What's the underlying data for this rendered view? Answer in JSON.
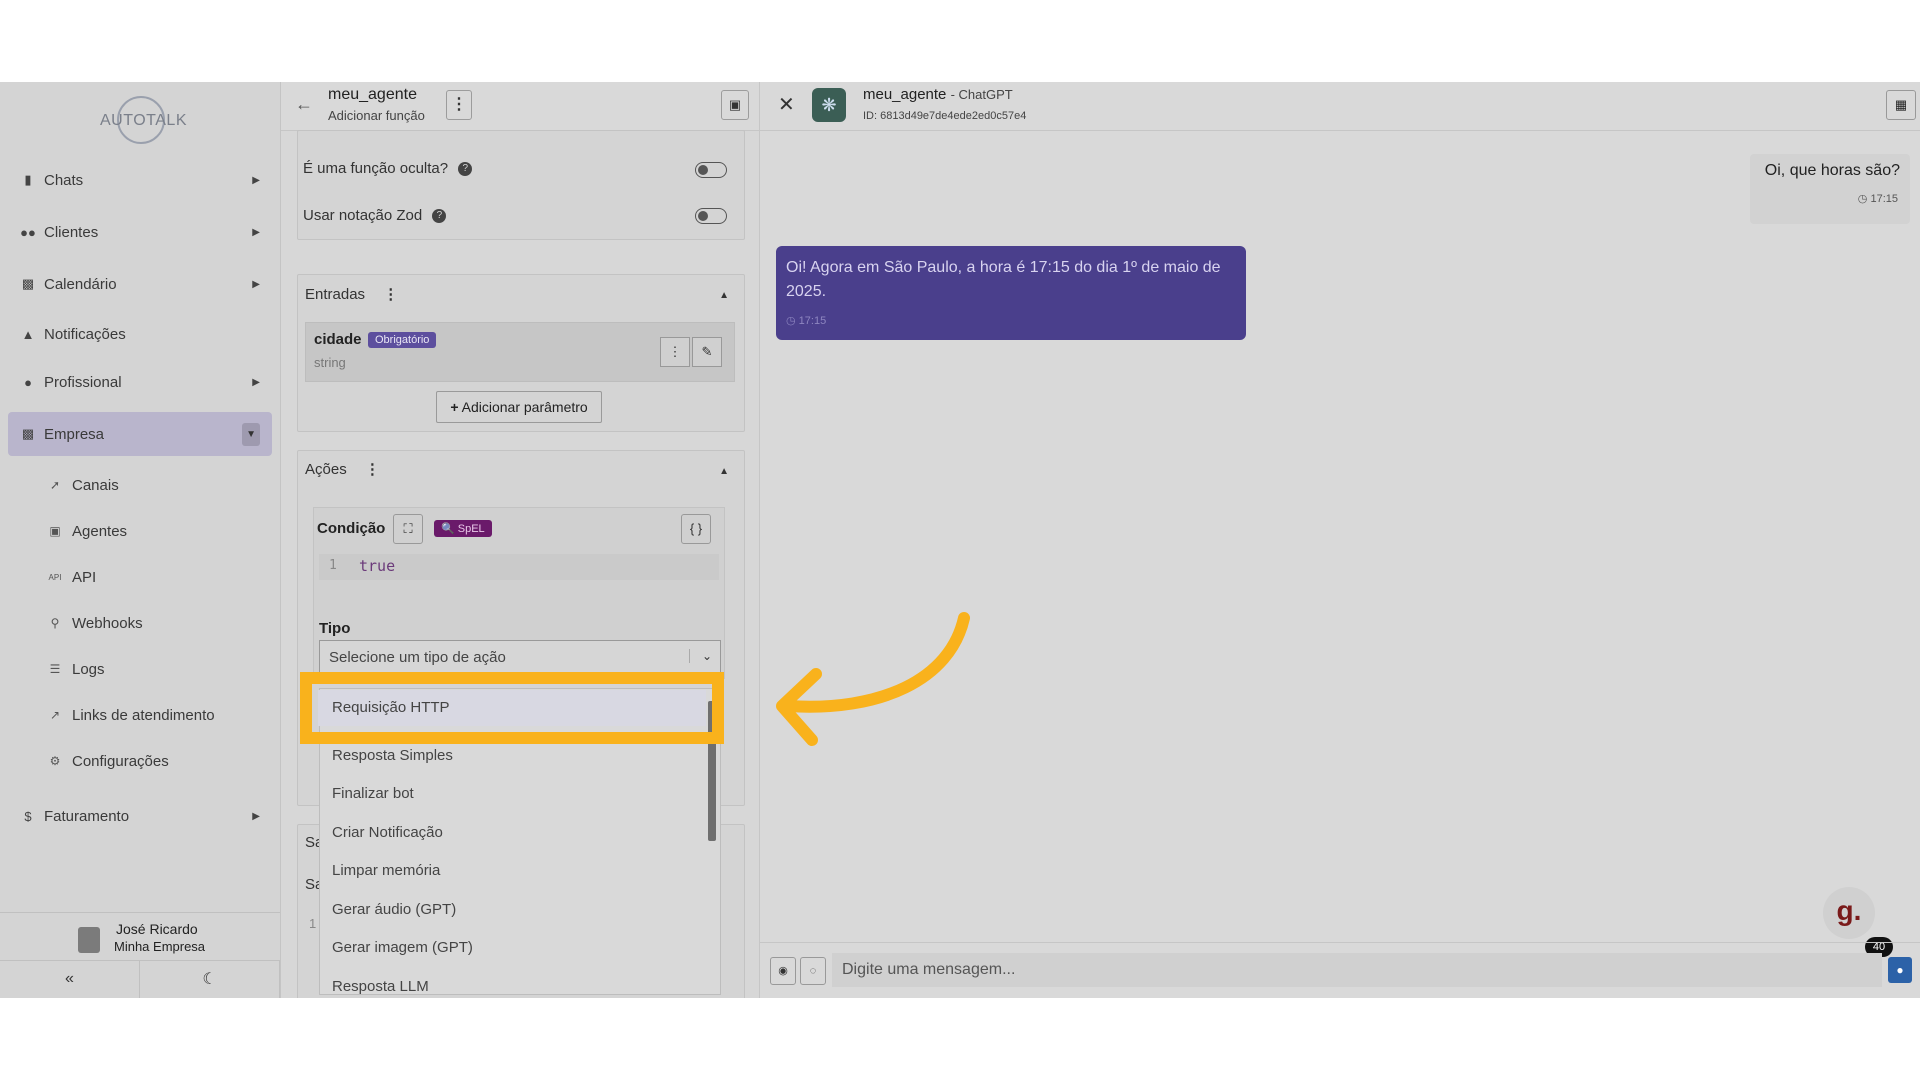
{
  "sidebar": {
    "logo": "AUTOTALK",
    "items": [
      {
        "label": "Chats",
        "icon": "chat-icon"
      },
      {
        "label": "Clientes",
        "icon": "users-icon"
      },
      {
        "label": "Calendário",
        "icon": "calendar-icon"
      },
      {
        "label": "Notificações",
        "icon": "bell-icon"
      },
      {
        "label": "Profissional",
        "icon": "user-tie-icon"
      },
      {
        "label": "Empresa",
        "icon": "building-icon"
      },
      {
        "label": "Faturamento",
        "icon": "dollar-icon"
      }
    ],
    "subitems": [
      {
        "label": "Canais",
        "icon": "rocket-icon"
      },
      {
        "label": "Agentes",
        "icon": "robot-icon"
      },
      {
        "label": "API",
        "icon": "api-icon"
      },
      {
        "label": "Webhooks",
        "icon": "webhook-icon"
      },
      {
        "label": "Logs",
        "icon": "list-icon"
      },
      {
        "label": "Links de atendimento",
        "icon": "external-link-icon"
      },
      {
        "label": "Configurações",
        "icon": "gear-icon"
      }
    ],
    "user": {
      "name": "José Ricardo",
      "company": "Minha Empresa"
    }
  },
  "editor": {
    "title": "meu_agente",
    "subtitle": "Adicionar função",
    "hidden_function_label": "É uma função oculta?",
    "zod_label": "Usar notação Zod",
    "inputs_title": "Entradas",
    "param": {
      "name": "cidade",
      "badge": "Obrigatório",
      "type": "string"
    },
    "add_param_label": "Adicionar parâmetro",
    "actions_title": "Ações",
    "condition_label": "Condição",
    "spel_label": "SpEL",
    "code_line_number": "1",
    "code_text": "true",
    "tipo_label": "Tipo",
    "select_placeholder": "Selecione um tipo de ação",
    "options": [
      "Requisição HTTP",
      "Resposta Simples",
      "Finalizar bot",
      "Criar Notificação",
      "Limpar memória",
      "Gerar áudio (GPT)",
      "Gerar imagem (GPT)",
      "Resposta LLM"
    ],
    "hidden_section_prefix": "Sa",
    "hidden_row_number": "1"
  },
  "chat": {
    "agent_name": "meu_agente",
    "model": "ChatGPT",
    "agent_id": "ID: 6813d49e7de4ede2ed0c57e4",
    "user_message": "Oi, que horas são?",
    "user_time": "17:15",
    "bot_message": "Oi! Agora em São Paulo, a hora é 17:15 do dia 1º de maio de 2025.",
    "bot_time": "17:15",
    "input_placeholder": "Digite uma mensagem...",
    "widget_letter": "g.",
    "widget_count": "40"
  },
  "colors": {
    "highlight": "#f9b21c",
    "bot_bubble": "#4a3f8c",
    "badge": "#5d4f9e",
    "spel": "#6a1a6a"
  }
}
